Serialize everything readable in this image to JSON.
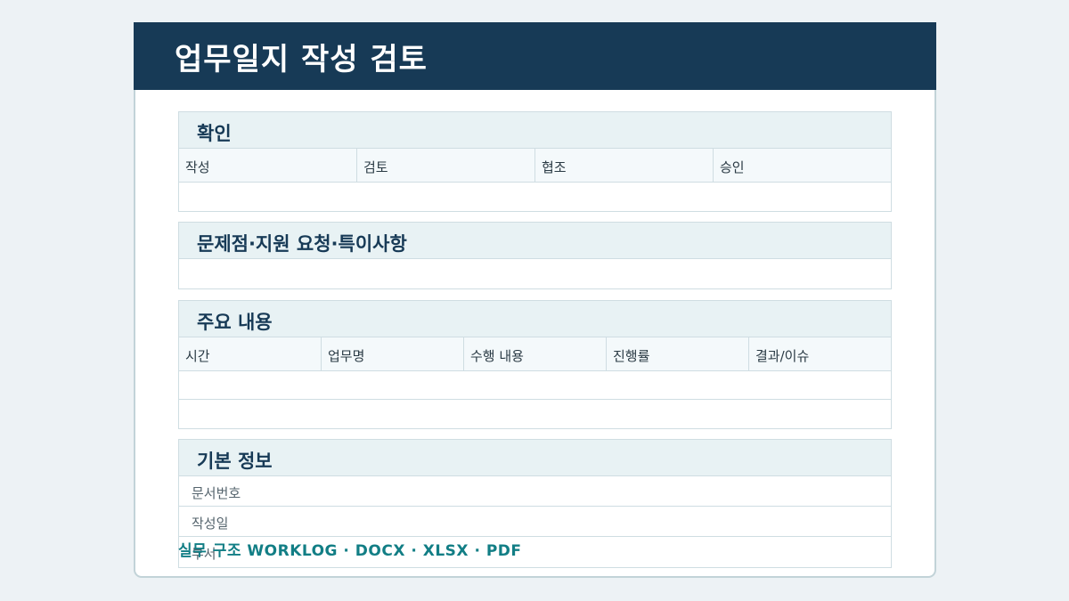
{
  "header": {
    "title": "업무일지 작성 검토"
  },
  "sections": {
    "approval": {
      "title": "확인",
      "columns": [
        "작성",
        "검토",
        "협조",
        "승인"
      ]
    },
    "issues": {
      "title": "문제점·지원 요청·특이사항"
    },
    "main": {
      "title": "주요 내용",
      "columns": [
        "시간",
        "업무명",
        "수행 내용",
        "진행률",
        "결과/이슈"
      ]
    },
    "basic": {
      "title": "기본 정보",
      "fields": [
        "문서번호",
        "작성일",
        "부서"
      ]
    }
  },
  "footer": {
    "text": "실무 구조 WORKLOG · DOCX · XLSX · PDF"
  },
  "colors": {
    "header_bg": "#173a56",
    "section_head_bg": "#e8f2f4",
    "accent": "#127e85"
  }
}
